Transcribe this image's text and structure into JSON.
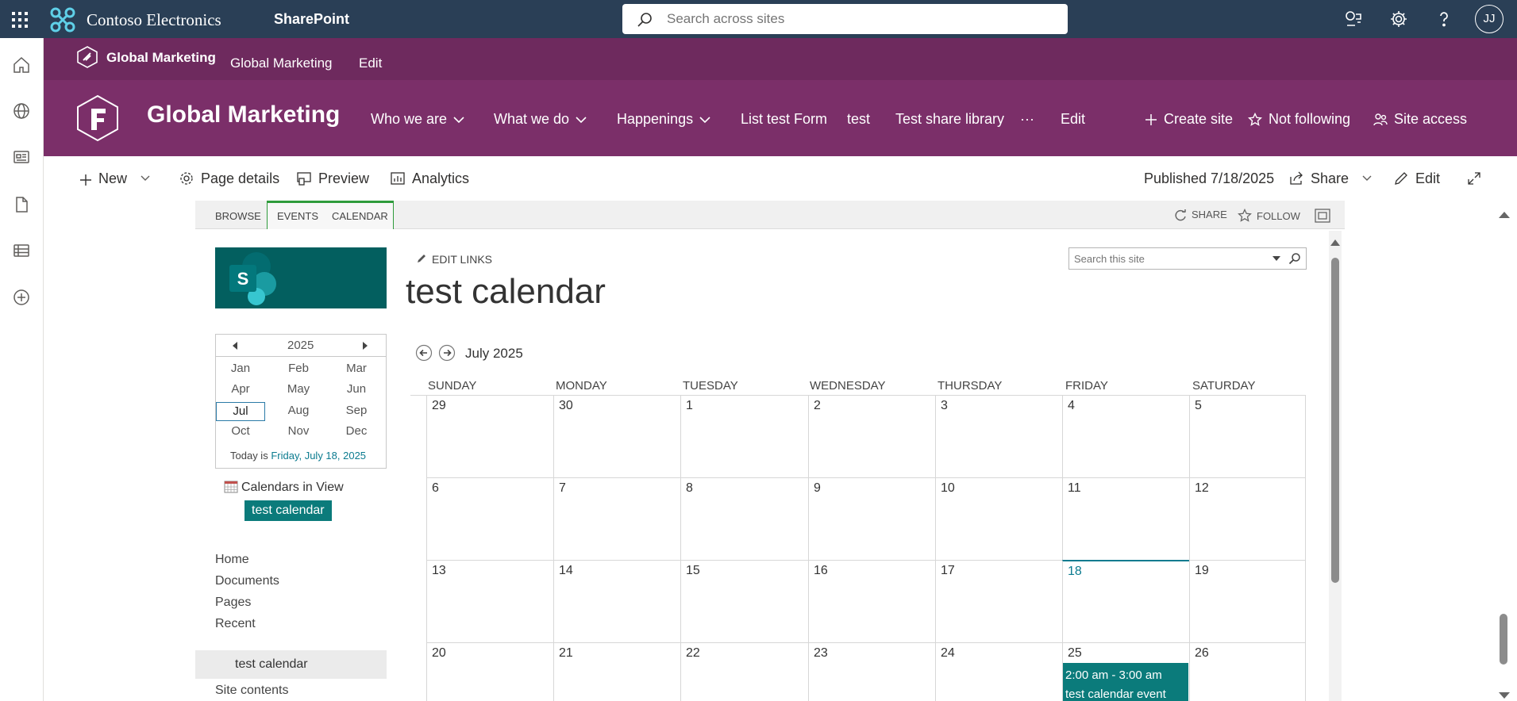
{
  "suitebar": {
    "org_name": "Contoso Electronics",
    "app_name": "SharePoint",
    "search_placeholder": "Search across sites",
    "avatar_initials": "JJ"
  },
  "hub": {
    "name": "Global Marketing",
    "links": [
      "Global Marketing",
      "Edit"
    ]
  },
  "site": {
    "title": "Global Marketing",
    "nav": [
      {
        "label": "Who we are",
        "dropdown": true
      },
      {
        "label": "What we do",
        "dropdown": true
      },
      {
        "label": "Happenings",
        "dropdown": true
      },
      {
        "label": "List test Form",
        "dropdown": false
      },
      {
        "label": "test",
        "dropdown": false
      },
      {
        "label": "Test share library",
        "dropdown": false
      },
      {
        "label": "···",
        "dropdown": false
      },
      {
        "label": "Edit",
        "dropdown": false
      }
    ],
    "actions": {
      "create_site": "Create site",
      "following": "Not following",
      "site_access": "Site access"
    },
    "accent": "#7b2f69"
  },
  "commandbar": {
    "new": "New",
    "page_details": "Page details",
    "preview": "Preview",
    "analytics": "Analytics",
    "published": "Published 7/18/2025",
    "share": "Share",
    "edit": "Edit"
  },
  "ribbon": {
    "tabs": [
      "BROWSE",
      "EVENTS",
      "CALENDAR"
    ],
    "share": "SHARE",
    "follow": "FOLLOW"
  },
  "classic": {
    "edit_links": "EDIT LINKS",
    "page_title": "test calendar",
    "site_search_placeholder": "Search this site"
  },
  "datepicker": {
    "year": "2025",
    "months": [
      "Jan",
      "Feb",
      "Mar",
      "Apr",
      "May",
      "Jun",
      "Jul",
      "Aug",
      "Sep",
      "Oct",
      "Nov",
      "Dec"
    ],
    "selected_month": "Jul",
    "today_prefix": "Today is",
    "today_link": "Friday, July 18, 2025"
  },
  "calendars_in_view": {
    "label": "Calendars in View",
    "calendars": [
      "test calendar"
    ]
  },
  "quicklaunch": [
    "Home",
    "Documents",
    "Pages",
    "Recent",
    "test calendar",
    "Site contents"
  ],
  "calendar": {
    "month_label": "July 2025",
    "day_headers": [
      "SUNDAY",
      "MONDAY",
      "TUESDAY",
      "WEDNESDAY",
      "THURSDAY",
      "FRIDAY",
      "SATURDAY"
    ],
    "weeks": [
      [
        "29",
        "30",
        "1",
        "2",
        "3",
        "4",
        "5"
      ],
      [
        "6",
        "7",
        "8",
        "9",
        "10",
        "11",
        "12"
      ],
      [
        "13",
        "14",
        "15",
        "16",
        "17",
        "18",
        "19"
      ],
      [
        "20",
        "21",
        "22",
        "23",
        "24",
        "25",
        "26"
      ]
    ],
    "today_date": "18",
    "events": [
      {
        "date": "25",
        "time": "2:00 am - 3:00 am",
        "title": "test calendar event"
      }
    ]
  }
}
